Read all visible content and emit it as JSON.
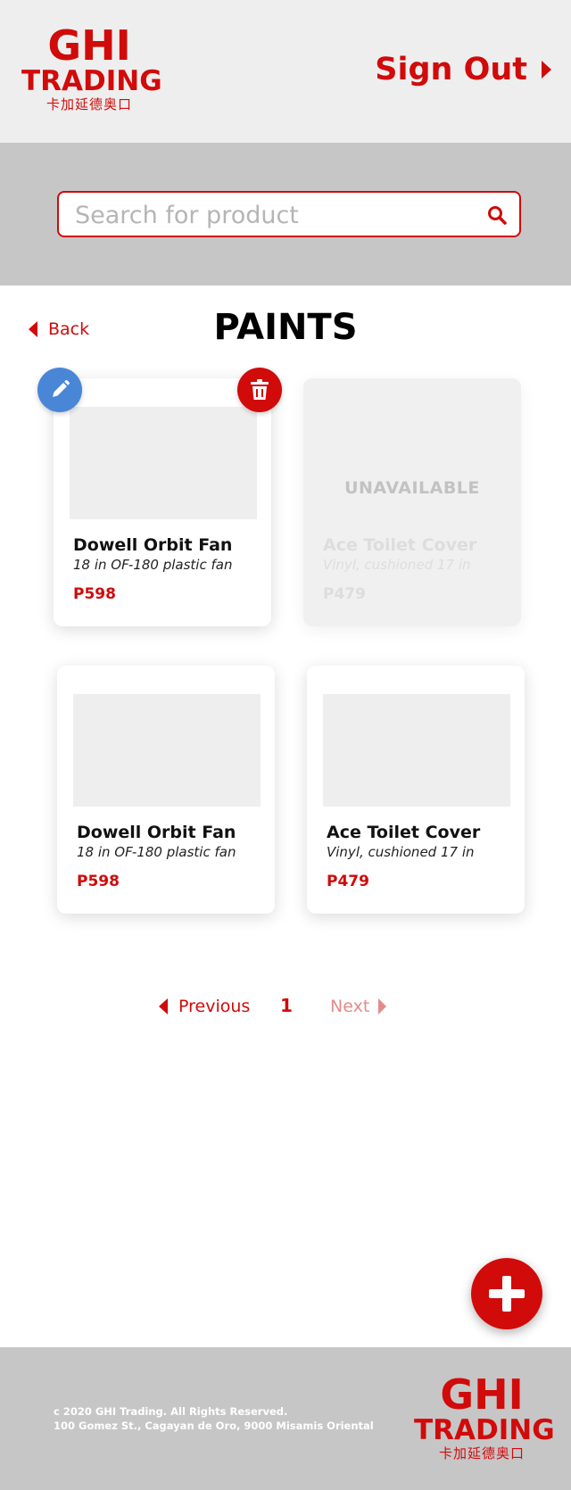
{
  "brand": {
    "name_line1": "GHI",
    "name_line2": "TRADING",
    "chinese": "卡加延德奥口",
    "color": "#d10a0a"
  },
  "header": {
    "sign_out_label": "Sign Out",
    "sign_out_icon": "caret-right-icon"
  },
  "search": {
    "placeholder": "Search for product",
    "value": "",
    "icon": "search-icon"
  },
  "page": {
    "back_label": "Back",
    "title": "PAINTS"
  },
  "products": [
    {
      "name": "Dowell Orbit Fan",
      "description": "18 in OF-180 plastic fan",
      "price": "P598",
      "available": true,
      "controls": [
        "pencil-icon",
        "trash-icon"
      ]
    },
    {
      "name": "Ace Toilet Cover",
      "description": "Vinyl, cushioned 17 in",
      "price": "P479",
      "available": false,
      "status_label": "UNAVAILABLE"
    },
    {
      "name": "Dowell Orbit Fan",
      "description": "18 in OF-180 plastic fan",
      "price": "P598",
      "available": true
    },
    {
      "name": "Ace Toilet Cover",
      "description": "Vinyl, cushioned 17 in",
      "price": "P479",
      "available": true
    }
  ],
  "pagination": {
    "previous_label": "Previous",
    "current_page": "1",
    "next_label": "Next"
  },
  "fab": {
    "icon": "plus-icon"
  },
  "footer": {
    "copyright": "c 2020 GHI Trading. All Rights Reserved.",
    "address": "100 Gomez St., Cagayan de Oro, 9000 Misamis Oriental"
  },
  "colors": {
    "accent": "#d10a0a",
    "edit": "#4a86d6",
    "header_bg": "#eeeeee",
    "band_bg": "#c6c6c6"
  }
}
